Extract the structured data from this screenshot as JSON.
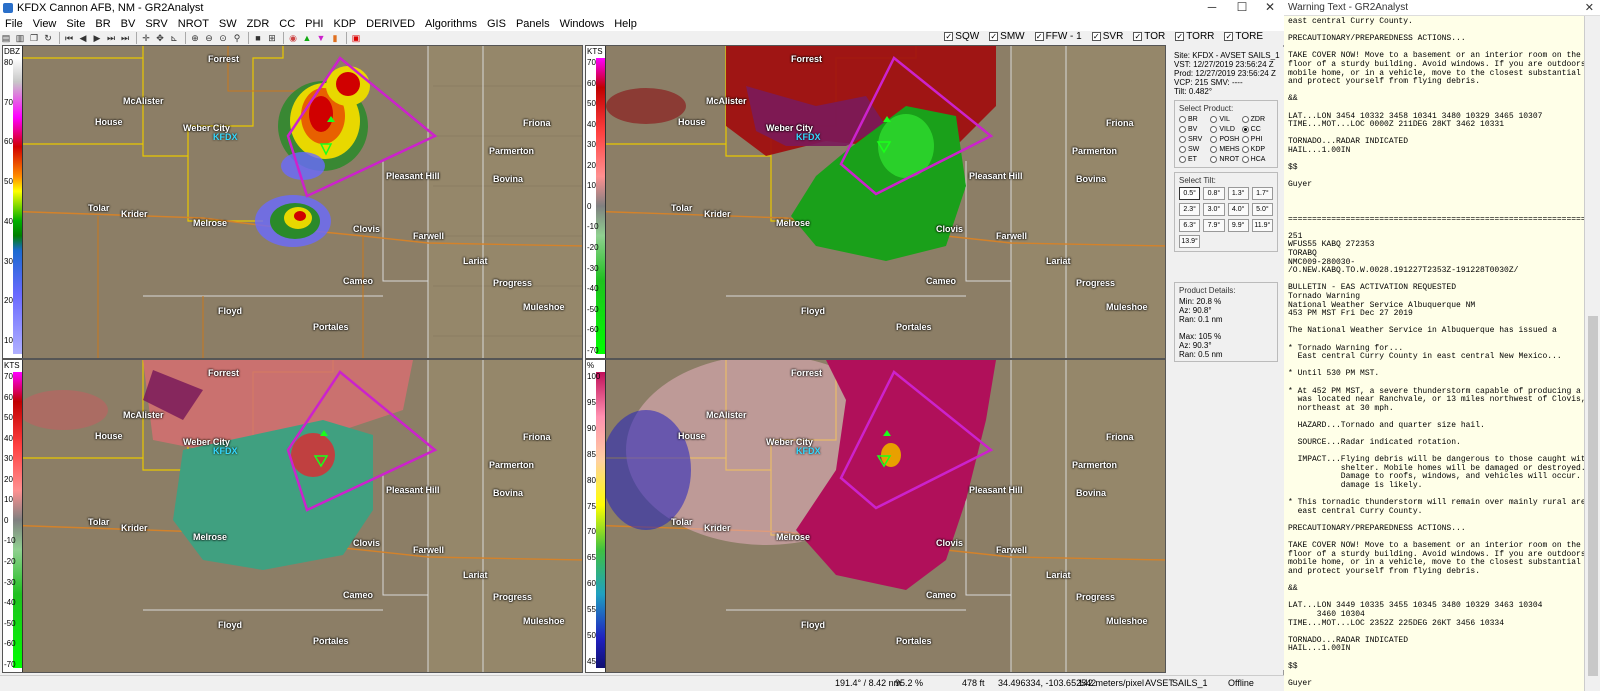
{
  "window": {
    "title": "KFDX Cannon AFB, NM - GR2Analyst",
    "minimize": "─",
    "maximize": "☐",
    "close": "✕"
  },
  "menu": [
    "File",
    "View",
    "Site",
    "BR",
    "BV",
    "SRV",
    "NROT",
    "SW",
    "ZDR",
    "CC",
    "PHI",
    "KDP",
    "DERIVED",
    "Algorithms",
    "GIS",
    "Panels",
    "Windows",
    "Help"
  ],
  "alert_toggles": [
    {
      "label": "SQW",
      "checked": true
    },
    {
      "label": "SMW",
      "checked": true
    },
    {
      "label": "FFW - 1",
      "checked": true
    },
    {
      "label": "SVR",
      "checked": true
    },
    {
      "label": "TOR",
      "checked": true
    },
    {
      "label": "TORR",
      "checked": true
    },
    {
      "label": "TORE",
      "checked": true
    }
  ],
  "panels": [
    {
      "unit": "DBZ",
      "ticks": [
        "80",
        "70",
        "60",
        "50",
        "40",
        "30",
        "20",
        "10"
      ]
    },
    {
      "unit": "KTS",
      "ticks": [
        "70",
        "60",
        "50",
        "40",
        "30",
        "20",
        "10",
        "0",
        "-10",
        "-20",
        "-30",
        "-40",
        "-50",
        "-60",
        "-70"
      ]
    },
    {
      "unit": "KTS",
      "ticks": [
        "70",
        "60",
        "50",
        "40",
        "30",
        "20",
        "10",
        "0",
        "-10",
        "-20",
        "-30",
        "-40",
        "-50",
        "-60",
        "-70"
      ]
    },
    {
      "unit": "%",
      "ticks": [
        "100",
        "95",
        "90",
        "85",
        "80",
        "75",
        "70",
        "65",
        "60",
        "55",
        "50",
        "45"
      ]
    }
  ],
  "cities": [
    "Forrest",
    "McAlister",
    "House",
    "Weber City",
    "Friona",
    "Parmerton",
    "Pleasant Hill",
    "Bovina",
    "Tolar",
    "Krider",
    "Melrose",
    "Clovis",
    "Farwell",
    "Lariat",
    "Cameo",
    "Progress",
    "Muleshoe",
    "Floyd",
    "Portales"
  ],
  "radar_id": "KFDX",
  "info": {
    "site": "Site:   KFDX - AVSET SAILS_1",
    "vst": "VST:    12/27/2019  23:56:24 Z",
    "prod": "Prod:   12/27/2019  23:56:24 Z",
    "vcp": "VCP:    215          SMV: ----",
    "tilt": "Tilt:   0.482°",
    "select_product": "Select Product:",
    "products": [
      {
        "label": "BR",
        "on": false
      },
      {
        "label": "VIL",
        "on": false
      },
      {
        "label": "ZDR",
        "on": false
      },
      {
        "label": "BV",
        "on": false
      },
      {
        "label": "VILD",
        "on": false
      },
      {
        "label": "CC",
        "on": true
      },
      {
        "label": "SRV",
        "on": false
      },
      {
        "label": "POSH",
        "on": false
      },
      {
        "label": "PHI",
        "on": false
      },
      {
        "label": "SW",
        "on": false
      },
      {
        "label": "MEHS",
        "on": false
      },
      {
        "label": "KDP",
        "on": false
      },
      {
        "label": "ET",
        "on": false
      },
      {
        "label": "NROT",
        "on": false
      },
      {
        "label": "HCA",
        "on": false
      }
    ],
    "select_tilt": "Select Tilt:",
    "tilts": [
      {
        "label": "0.5°",
        "on": true
      },
      {
        "label": "0.8°",
        "on": false
      },
      {
        "label": "1.3°",
        "on": false
      },
      {
        "label": "1.7°",
        "on": false
      },
      {
        "label": "2.3°",
        "on": false
      },
      {
        "label": "3.0°",
        "on": false
      },
      {
        "label": "4.0°",
        "on": false
      },
      {
        "label": "5.0°",
        "on": false
      },
      {
        "label": "6.3°",
        "on": false
      },
      {
        "label": "7.9°",
        "on": false
      },
      {
        "label": "9.9°",
        "on": false
      },
      {
        "label": "11.9°",
        "on": false
      },
      {
        "label": "13.9°",
        "on": false
      }
    ],
    "product_details": "Product Details:",
    "details": [
      "Min:  20.8 %",
      "Az:   90.8°",
      "Ran:  0.1 nm",
      "",
      "Max:  105 %",
      "Az:   90.3°",
      "Ran:  0.5 nm"
    ]
  },
  "status": {
    "coords": "191.4° / 8.42 nm",
    "value": "95.2 %",
    "height": "478 ft",
    "latlon": "34.496334, -103.652542",
    "scale": "142 meters/pixel",
    "mode": "AVSET",
    "sails": "SAILS_1",
    "conn": "Offline"
  },
  "warning": {
    "title": "Warning Text - GR2Analyst",
    "text": "east central Curry County.\n\nPRECAUTIONARY/PREPAREDNESS ACTIONS...\n\nTAKE COVER NOW! Move to a basement or an interior room on the lowest\nfloor of a sturdy building. Avoid windows. If you are outdoors, in a\nmobile home, or in a vehicle, move to the closest substantial shelter\nand protect yourself from flying debris.\n\n&&\n\nLAT...LON 3454 10332 3458 10341 3480 10329 3465 10307\nTIME...MOT...LOC 0000Z 211DEG 28KT 3462 10331\n\nTORNADO...RADAR INDICATED\nHAIL...1.00IN\n\n$$\n\nGuyer\n\n\n\n=================================================================\n\n251\nWFUS55 KABQ 272353\nTORABQ\nNMC009-280030-\n/O.NEW.KABQ.TO.W.0028.191227T2353Z-191228T0030Z/\n\nBULLETIN - EAS ACTIVATION REQUESTED\nTornado Warning\nNational Weather Service Albuquerque NM\n453 PM MST Fri Dec 27 2019\n\nThe National Weather Service in Albuquerque has issued a\n\n* Tornado Warning for...\n  East central Curry County in east central New Mexico...\n\n* Until 530 PM MST.\n\n* At 452 PM MST, a severe thunderstorm capable of producing a tornado\n  was located near Ranchvale, or 13 miles northwest of Clovis, moving\n  northeast at 30 mph.\n\n  HAZARD...Tornado and quarter size hail.\n\n  SOURCE...Radar indicated rotation.\n\n  IMPACT...Flying debris will be dangerous to those caught without\n           shelter. Mobile homes will be damaged or destroyed.\n           Damage to roofs, windows, and vehicles will occur.  Tree\n           damage is likely.\n\n* This tornadic thunderstorm will remain over mainly rural areas of\n  east central Curry County.\n\nPRECAUTIONARY/PREPAREDNESS ACTIONS...\n\nTAKE COVER NOW! Move to a basement or an interior room on the lowest\nfloor of a sturdy building. Avoid windows. If you are outdoors, in a\nmobile home, or in a vehicle, move to the closest substantial shelter\nand protect yourself from flying debris.\n\n&&\n\nLAT...LON 3449 10335 3455 10345 3480 10329 3463 10304\n      3460 10304\nTIME...MOT...LOC 2352Z 225DEG 26KT 3456 10334\n\nTORNADO...RADAR INDICATED\nHAIL...1.00IN\n\n$$\n\nGuyer"
  },
  "colors": {
    "warning_polygon": "#cc22cc",
    "county_line": "#e8c800",
    "road": "#d4822a",
    "radar_label": "#34d9ff"
  }
}
